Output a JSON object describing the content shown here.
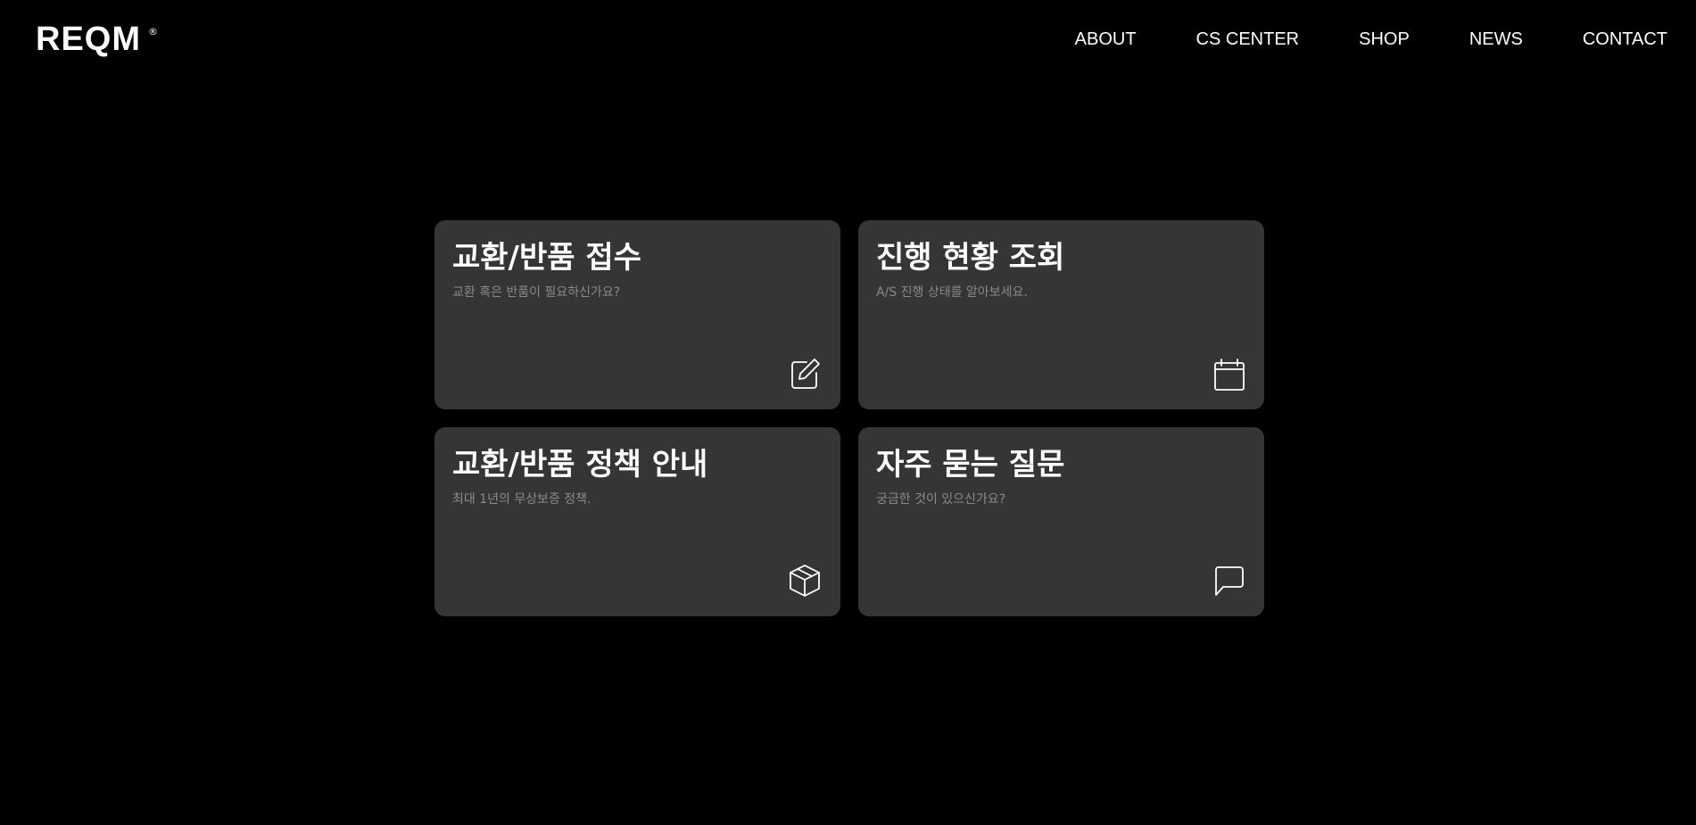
{
  "brand": {
    "logo_text": "REQM",
    "registered_mark": "®"
  },
  "nav": {
    "items": [
      {
        "label": "ABOUT"
      },
      {
        "label": "CS CENTER"
      },
      {
        "label": "SHOP"
      },
      {
        "label": "NEWS"
      },
      {
        "label": "CONTACT"
      }
    ]
  },
  "cards": [
    {
      "title": "교환/반품 접수",
      "description": "교환 혹은 반품이 필요하신가요?",
      "icon": "edit-icon"
    },
    {
      "title": "진행 현황 조회",
      "description": "A/S 진행 상태를 알아보세요.",
      "icon": "calendar-icon"
    },
    {
      "title": "교환/반품 정책 안내",
      "description": "최대 1년의 무상보증 정책.",
      "icon": "box-icon"
    },
    {
      "title": "자주 묻는 질문",
      "description": "궁금한 것이 있으신가요?",
      "icon": "chat-bubble-icon"
    }
  ],
  "colors": {
    "background": "#000000",
    "card_background": "#353535",
    "text_primary": "#ffffff",
    "text_secondary": "#8a8a8a"
  }
}
